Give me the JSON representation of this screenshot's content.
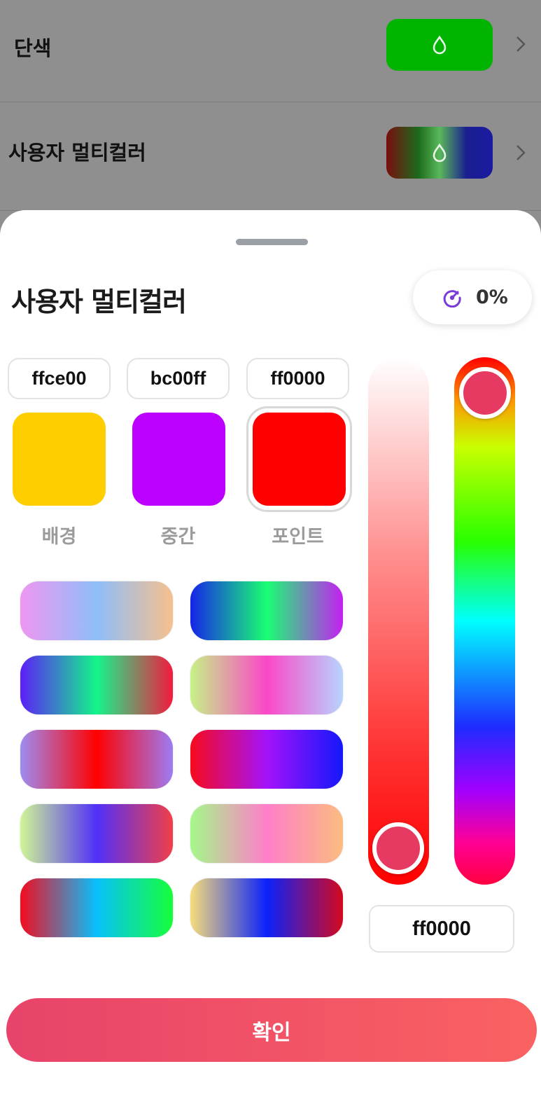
{
  "background_list": {
    "items": [
      {
        "label": "단색"
      },
      {
        "label": "사용자 멀티컬러"
      }
    ]
  },
  "sheet": {
    "title": "사용자 멀티컬러",
    "opacity_value": "0%",
    "swatches": [
      {
        "hex": "ffce00",
        "label": "배경",
        "color": "#ffce00"
      },
      {
        "hex": "bc00ff",
        "label": "중간",
        "color": "#bc00ff"
      },
      {
        "hex": "ff0000",
        "label": "포인트",
        "color": "#ff0000",
        "selected": true
      }
    ],
    "presets": [
      [
        "#ef96f1",
        "#8fbef9",
        "#f6c08e"
      ],
      [
        "#1624e8",
        "#19ff72",
        "#c41ff2"
      ],
      [
        "#5b1ff7",
        "#13f58a",
        "#f41a3e"
      ],
      [
        "#c6f286",
        "#fb47c8",
        "#b7d4fe"
      ],
      [
        "#9e8cf2",
        "#ff0000",
        "#9d7cf4"
      ],
      [
        "#f70a1d",
        "#a412fb",
        "#1418fb"
      ],
      [
        "#cff694",
        "#5030f8",
        "#f13f48"
      ],
      [
        "#a4f98a",
        "#ff7ec9",
        "#fbbc80"
      ],
      [
        "#f30b1f",
        "#08c0fc",
        "#15ff3a"
      ],
      [
        "#f7dc7a",
        "#0a22fb",
        "#d5081e"
      ]
    ],
    "current_hex": "ff0000",
    "confirm_label": "확인"
  },
  "colors": {
    "accent": "#e63a62",
    "solid_swatch": "#00b400",
    "icon_purple": "#7a3ad9"
  },
  "icons": {
    "drop": "drop-icon",
    "chevron": "chevron-right-icon",
    "opacity": "opacity-gauge-icon"
  }
}
